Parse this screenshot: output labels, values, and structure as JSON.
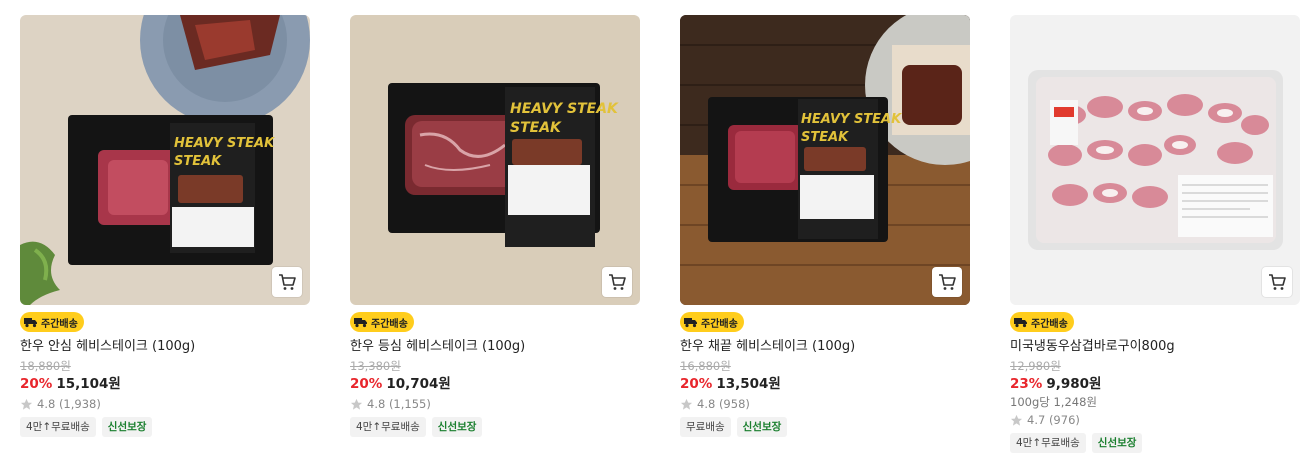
{
  "products": [
    {
      "badge": "주간배송",
      "name": "한우 안심 헤비스테이크 (100g)",
      "original_price": "18,880원",
      "discount": "20%",
      "price": "15,104원",
      "unit_price": "",
      "rating": "4.8 (1,938)",
      "tags": [
        "4만↑무료배송",
        "신선보장"
      ],
      "image_label": "HEAVY STEAK"
    },
    {
      "badge": "주간배송",
      "name": "한우 등심 헤비스테이크 (100g)",
      "original_price": "13,380원",
      "discount": "20%",
      "price": "10,704원",
      "unit_price": "",
      "rating": "4.8 (1,155)",
      "tags": [
        "4만↑무료배송",
        "신선보장"
      ],
      "image_label": "HEAVY STEAK"
    },
    {
      "badge": "주간배송",
      "name": "한우 채끝 헤비스테이크 (100g)",
      "original_price": "16,880원",
      "discount": "20%",
      "price": "13,504원",
      "unit_price": "",
      "rating": "4.8 (958)",
      "tags": [
        "무료배송",
        "신선보장"
      ],
      "image_label": "HEAVY STEAK"
    },
    {
      "badge": "주간배송",
      "name": "미국냉동우삼겹바로구이800g",
      "original_price": "12,980원",
      "discount": "23%",
      "price": "9,980원",
      "unit_price": "100g당 1,248원",
      "rating": "4.7 (976)",
      "tags": [
        "4만↑무료배송",
        "신선보장"
      ],
      "image_label": ""
    }
  ],
  "colors": {
    "discount": "#e8262c",
    "badge_bg": "#ffcd1c",
    "fresh_tag": "#1a7f2e"
  },
  "icons": {
    "cart": "cart-icon",
    "star": "star-icon",
    "delivery": "truck-icon"
  }
}
